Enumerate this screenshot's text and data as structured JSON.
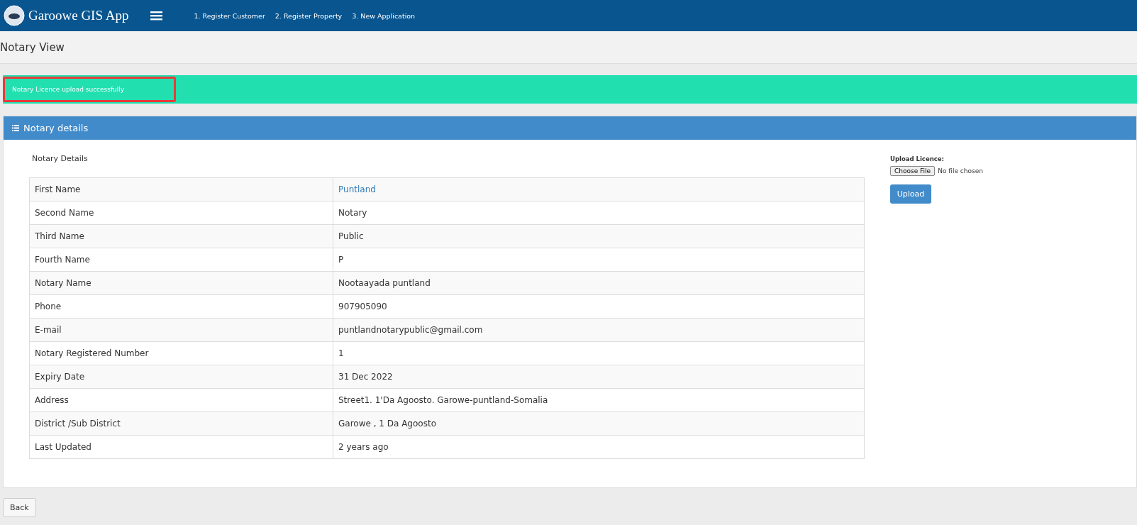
{
  "header": {
    "app_name": "Garoowe GIS App",
    "nav": [
      "1. Register Customer",
      "2. Register Property",
      "3. New Application"
    ]
  },
  "page_title": "Notary View",
  "alert": {
    "message": "Notary Licence upload successfully",
    "highlighted": true
  },
  "panel": {
    "title": "Notary details",
    "section_heading": "Notary Details",
    "rows": [
      {
        "label": "First Name",
        "value": "Puntland",
        "kind": "link"
      },
      {
        "label": "Second Name",
        "value": "Notary",
        "kind": "text"
      },
      {
        "label": "Third Name",
        "value": "Public",
        "kind": "text"
      },
      {
        "label": "Fourth Name",
        "value": "P",
        "kind": "text"
      },
      {
        "label": "Notary Name",
        "value": "Nootaayada puntland",
        "kind": "text"
      },
      {
        "label": "Phone",
        "value": "907905090",
        "kind": "text"
      },
      {
        "label": "E-mail",
        "value": "puntlandnotarypublic@gmail.com",
        "kind": "text"
      },
      {
        "label": "Notary Registered Number",
        "value": "1",
        "kind": "text"
      },
      {
        "label": "Expiry Date",
        "value": "31 Dec 2022",
        "kind": "text"
      },
      {
        "label": "Address",
        "value": "Street1. 1'Da Agoosto. Garowe-puntland-Somalia",
        "kind": "text"
      },
      {
        "label": "District /Sub District",
        "value": "Garowe , 1 Da Agoosto",
        "kind": "text"
      },
      {
        "label": "Last Updated",
        "value": "2 years ago",
        "kind": "text"
      }
    ],
    "upload": {
      "label": "Upload Licence:",
      "choose_button": "Choose File",
      "file_status": "No file chosen",
      "upload_button": "Upload"
    }
  },
  "back_button": "Back"
}
